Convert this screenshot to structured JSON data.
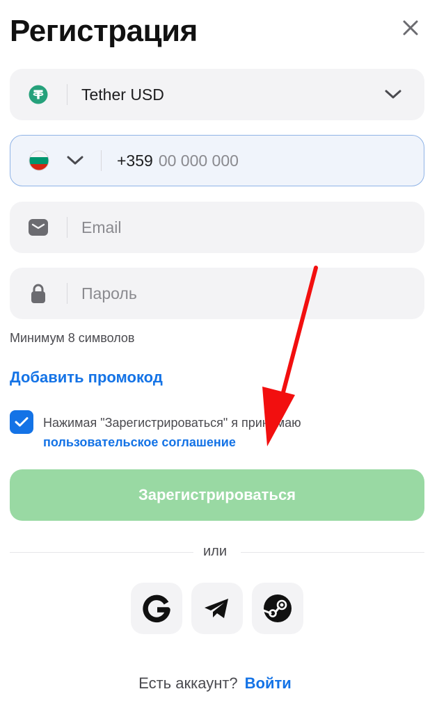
{
  "header": {
    "title": "Регистрация",
    "close_icon": "close-icon"
  },
  "currency": {
    "value": "Tether USD",
    "icon": "tether-icon",
    "icon_color": "#26a17b"
  },
  "phone": {
    "country_flag": "bulgaria-flag-icon",
    "code": "+359",
    "placeholder": "00 000 000"
  },
  "email": {
    "placeholder": "Email",
    "icon": "mail-icon"
  },
  "password": {
    "placeholder": "Пароль",
    "icon": "lock-icon",
    "hint": "Минимум 8 символов"
  },
  "promo": {
    "label": "Добавить промокод"
  },
  "agreement": {
    "checked": true,
    "text": "Нажимая \"Зарегистрироваться\" я принимаю",
    "link": "пользовательское соглашение"
  },
  "submit": {
    "label": "Зарегистрироваться",
    "color": "#99d9a3"
  },
  "divider": {
    "label": "или"
  },
  "social": [
    "google-icon",
    "telegram-icon",
    "steam-icon"
  ],
  "footer": {
    "question": "Есть аккаунт?",
    "login": "Войти"
  },
  "colors": {
    "accent": "#1473e6",
    "annotation_arrow": "#f20f0f"
  }
}
